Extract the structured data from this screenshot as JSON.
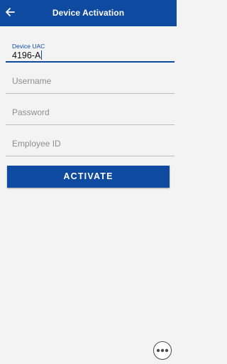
{
  "app_bar": {
    "title": "Device Activation",
    "back_icon": "arrow-left-icon",
    "background_color": "#0d4aa0"
  },
  "form": {
    "device_uac": {
      "label": "Device UAC",
      "value": "4196-A"
    },
    "username": {
      "placeholder": "Username",
      "value": ""
    },
    "password": {
      "placeholder": "Password",
      "value": ""
    },
    "employee_id": {
      "placeholder": "Employee ID",
      "value": ""
    },
    "activate_label": "ACTIVATE"
  },
  "floating": {
    "more_icon": "more-horizontal-icon"
  }
}
